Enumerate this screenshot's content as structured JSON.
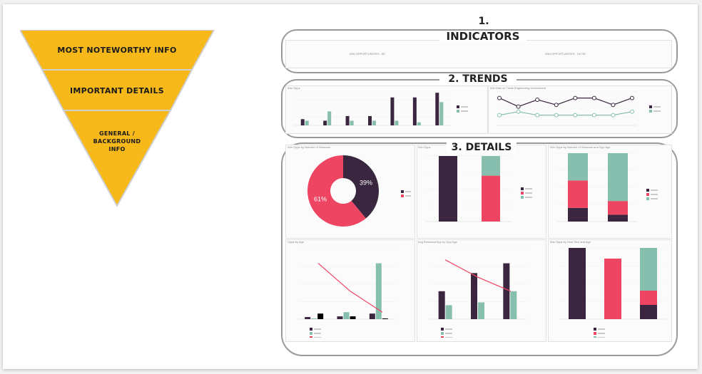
{
  "pyramid": {
    "levels": [
      {
        "label_lines": [
          "MOST NOTEWORTHY INFO"
        ]
      },
      {
        "label_lines": [
          "IMPORTANT DETAILS"
        ]
      },
      {
        "label_lines": [
          "GENERAL /",
          "BACKGROUND",
          "INFO"
        ]
      }
    ]
  },
  "sections": {
    "indicators": {
      "number": "1.",
      "title": "INDICATORS"
    },
    "trends": {
      "title": "2. TRENDS"
    },
    "details": {
      "title": "3. DETAILS"
    }
  },
  "dashboard": {
    "kpi_left": "WIN OPPORTUNITIES - 5E",
    "kpi_right": "WIN OPPORTUNITIES - NO 5E",
    "trend_left_title": "Win Opps",
    "trend_right_title": "Win Rate w/ Trade Engineering Involvement",
    "pie_title": "Win Opps by Number of Sessions",
    "bar_title": "Win Opps",
    "stack_title": "Win Opps by Number of Sessions and Opp Age",
    "opps_age_title": "Opps by Age",
    "sessions_age_title": "Avg Sessions/Opp by Opp Age",
    "deal_title": "Win Opps by Deal Size and Age"
  },
  "colors": {
    "pyramid_fill": "#f7b81a",
    "dark": "#3b2640",
    "red": "#ee4562",
    "teal": "#86bfae",
    "frame": "#9a9a9a"
  },
  "chart_data": [
    {
      "type": "bar",
      "series": [
        {
          "values": [
            4,
            3,
            6,
            6,
            18,
            18,
            21
          ]
        },
        {
          "values": [
            3,
            9,
            3,
            3,
            3,
            2,
            15
          ]
        }
      ]
    },
    {
      "type": "line",
      "series": [
        {
          "values": [
            80,
            55,
            75,
            60,
            80,
            80,
            60,
            80
          ]
        },
        {
          "values": [
            30,
            40,
            30,
            30,
            30,
            30,
            30,
            40
          ]
        }
      ]
    },
    {
      "type": "pie",
      "values": [
        39,
        61
      ],
      "labels": [
        "39%",
        "61%"
      ]
    },
    {
      "type": "bar",
      "stacked": true,
      "categories": [
        "1",
        "1+"
      ],
      "series": [
        {
          "values": [
            100,
            0
          ]
        },
        {
          "values": [
            0,
            70
          ]
        },
        {
          "values": [
            0,
            30
          ]
        }
      ]
    },
    {
      "type": "bar",
      "stacked": true,
      "series": [
        {
          "values": [
            20,
            10
          ]
        },
        {
          "values": [
            40,
            20
          ]
        },
        {
          "values": [
            40,
            70
          ]
        }
      ]
    },
    {
      "type": "bar",
      "series": [
        {
          "values": [
            30,
            40,
            80
          ]
        },
        {
          "values": [
            10,
            100,
            800
          ]
        },
        {
          "values": [
            80,
            40,
            10
          ]
        }
      ]
    },
    {
      "type": "bar",
      "series": [
        {
          "values": [
            2,
            3.3,
            4
          ]
        },
        {
          "values": [
            1,
            1.2,
            2
          ]
        },
        {
          "values": [
            85,
            60,
            40
          ]
        }
      ]
    },
    {
      "type": "bar",
      "stacked": true,
      "series": [
        {
          "values": [
            100,
            0,
            20
          ]
        },
        {
          "values": [
            0,
            85,
            20
          ]
        },
        {
          "values": [
            0,
            0,
            60
          ]
        }
      ]
    }
  ]
}
